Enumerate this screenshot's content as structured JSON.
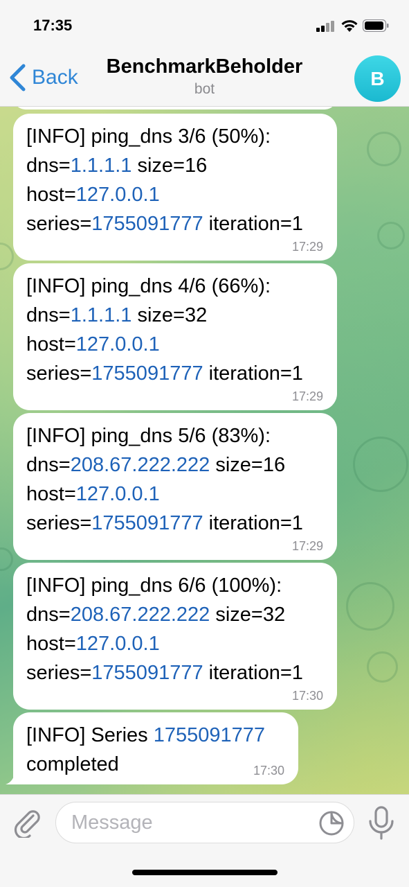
{
  "status_bar": {
    "time": "17:35"
  },
  "header": {
    "back_label": "Back",
    "title": "BenchmarkBeholder",
    "subtitle": "bot",
    "avatar_letter": "B",
    "avatar_color": "#1bb9d0"
  },
  "colors": {
    "link_blue": "#1e62b8",
    "accent": "#2f86d6"
  },
  "messages": [
    {
      "line1": "[INFO]  ping_dns 3/6 (50%):",
      "dns_label": "dns=",
      "dns": "1.1.1.1",
      "size": " size=16",
      "host_label": "host=",
      "host": "127.0.0.1",
      "series_label": "series=",
      "series": "1755091777",
      "iteration": " iteration=1",
      "time": "17:29"
    },
    {
      "line1": "[INFO]  ping_dns 4/6 (66%):",
      "dns_label": "dns=",
      "dns": "1.1.1.1",
      "size": " size=32",
      "host_label": "host=",
      "host": "127.0.0.1",
      "series_label": "series=",
      "series": "1755091777",
      "iteration": " iteration=1",
      "time": "17:29"
    },
    {
      "line1": "[INFO]  ping_dns 5/6 (83%):",
      "dns_label": "dns=",
      "dns": "208.67.222.222",
      "size": " size=16",
      "host_label": "host=",
      "host": "127.0.0.1",
      "series_label": "series=",
      "series": "1755091777",
      "iteration": " iteration=1",
      "time": "17:29"
    },
    {
      "line1": "[INFO]  ping_dns 6/6 (100%):",
      "dns_label": "dns=",
      "dns": "208.67.222.222",
      "size": " size=32",
      "host_label": "host=",
      "host": "127.0.0.1",
      "series_label": "series=",
      "series": "1755091777",
      "iteration": " iteration=1",
      "time": "17:30"
    }
  ],
  "final_message": {
    "prefix": "[INFO] Series ",
    "series": "1755091777",
    "line2": "completed",
    "time": "17:30"
  },
  "input": {
    "placeholder": "Message"
  },
  "icons": {
    "back": "chevron-left-icon",
    "attach": "paperclip-icon",
    "sticker": "sticker-icon",
    "mic": "microphone-icon"
  }
}
